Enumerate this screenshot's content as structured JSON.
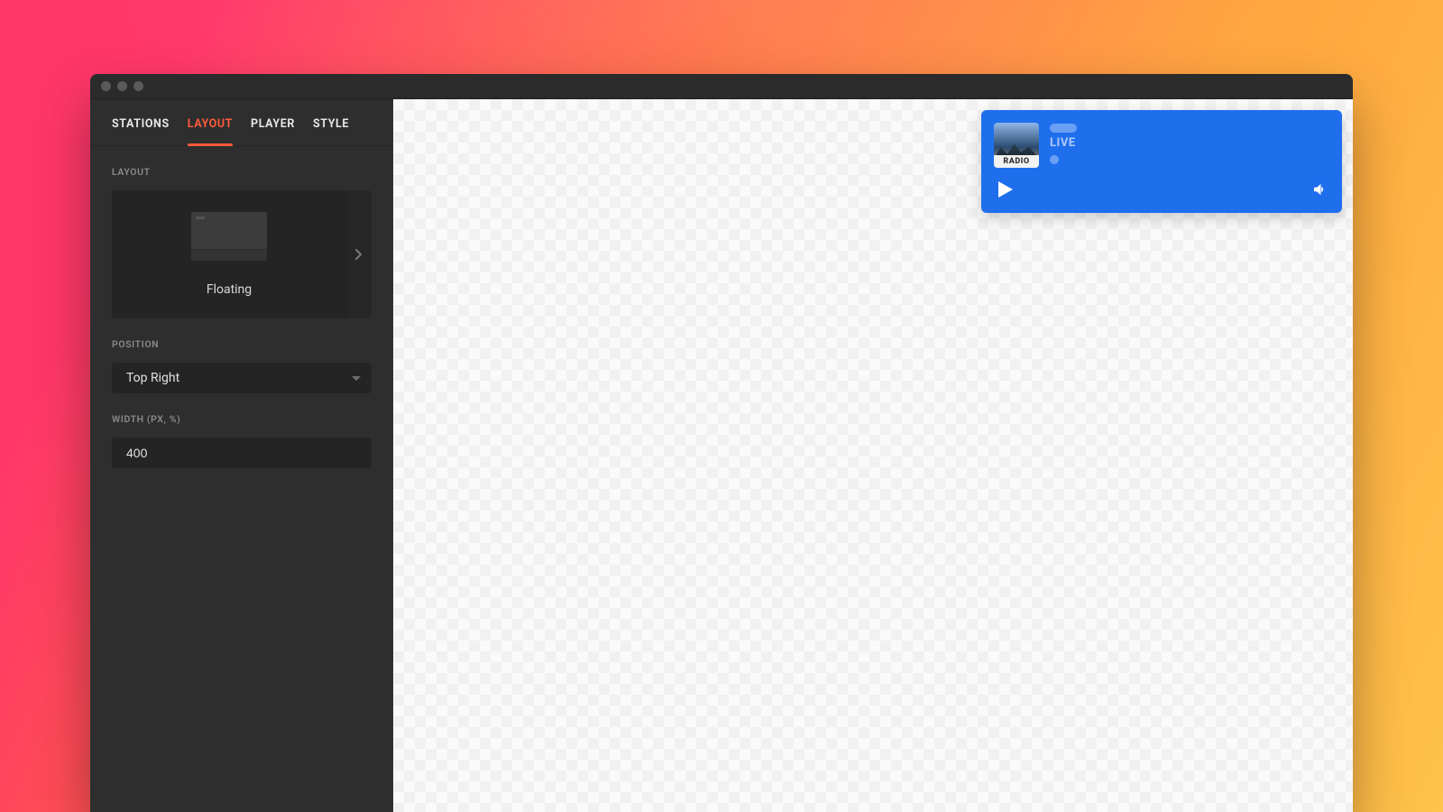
{
  "tabs": {
    "stations": "STATIONS",
    "layout": "LAYOUT",
    "player": "PLAYER",
    "style": "STYLE",
    "active": "layout"
  },
  "sections": {
    "layout_label": "LAYOUT",
    "position_label": "POSITION",
    "width_label": "WIDTH (PX, %)"
  },
  "layout_picker": {
    "selected_name": "Floating"
  },
  "position": {
    "value": "Top Right"
  },
  "width": {
    "value": "400"
  },
  "player": {
    "cover_text": "RADIO",
    "status": "LIVE"
  }
}
